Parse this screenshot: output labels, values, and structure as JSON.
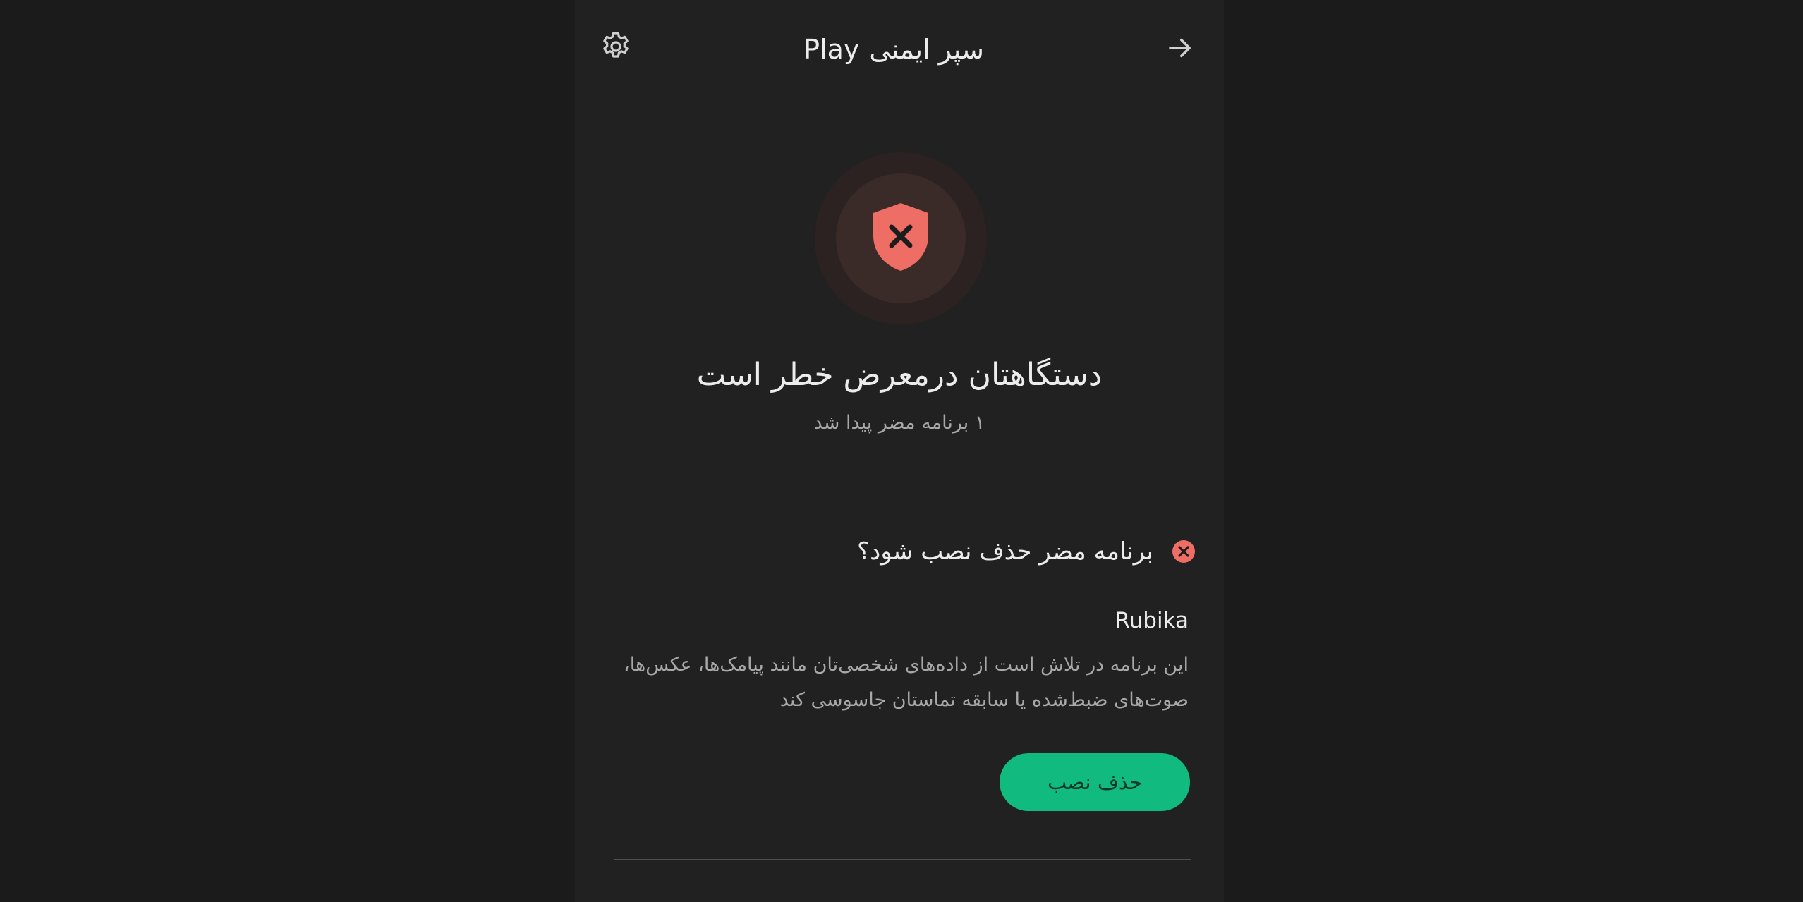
{
  "topbar": {
    "title_fa": "سپر ایمنی",
    "title_brand": "Play",
    "settings_icon": "gear-icon",
    "back_icon": "arrow-right-icon"
  },
  "status": {
    "icon": "shield-x-icon",
    "headline": "دستگاهتان درمعرض خطر است",
    "subline": "۱ برنامه مضر پیدا شد"
  },
  "threat": {
    "question": "برنامه مضر حذف نصب شود؟",
    "app_name": "Rubika",
    "description": "این برنامه در تلاش است از داده‌های شخصی‌تان مانند پیامک‌ها، عکس‌ها، صوت‌های ضبط‌شده یا سابقه تماستان جاسوسی کند",
    "uninstall_label": "حذف نصب"
  },
  "colors": {
    "background": "#212121",
    "danger": "#ee6e66",
    "accent": "#11ba7f"
  }
}
